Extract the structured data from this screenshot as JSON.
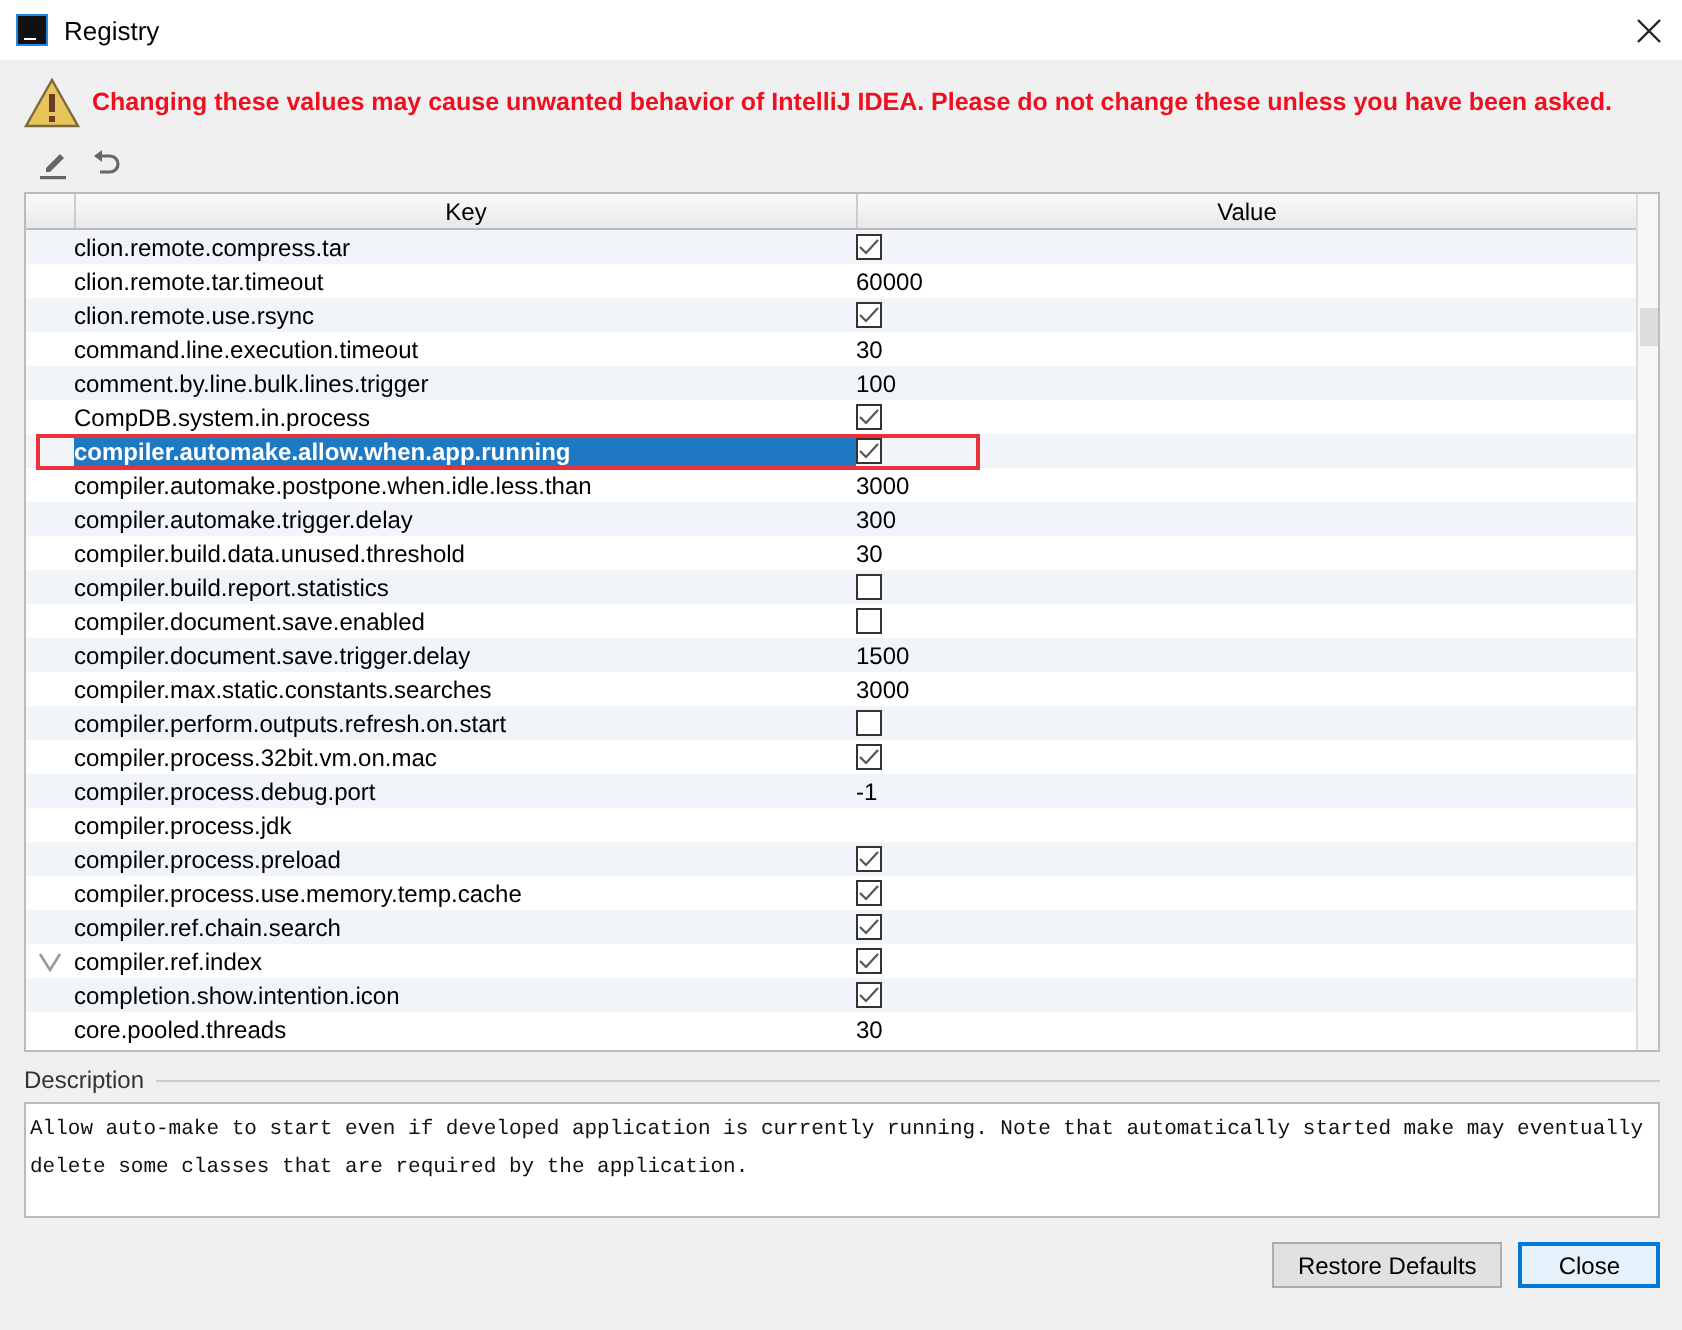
{
  "window": {
    "title": "Registry"
  },
  "warning": "Changing these values may cause unwanted behavior of IntelliJ IDEA. Please do not change these unless you have been asked.",
  "table": {
    "columns": [
      "Key",
      "Value"
    ],
    "rows": [
      {
        "key": "clion.remote.compress.tar",
        "kind": "checkbox",
        "checked": true,
        "selected": false,
        "modified": false,
        "annotated": false
      },
      {
        "key": "clion.remote.tar.timeout",
        "kind": "text",
        "value": "60000",
        "selected": false,
        "modified": false,
        "annotated": false
      },
      {
        "key": "clion.remote.use.rsync",
        "kind": "checkbox",
        "checked": true,
        "selected": false,
        "modified": false,
        "annotated": false
      },
      {
        "key": "command.line.execution.timeout",
        "kind": "text",
        "value": "30",
        "selected": false,
        "modified": false,
        "annotated": false
      },
      {
        "key": "comment.by.line.bulk.lines.trigger",
        "kind": "text",
        "value": "100",
        "selected": false,
        "modified": false,
        "annotated": false
      },
      {
        "key": "CompDB.system.in.process",
        "kind": "checkbox",
        "checked": true,
        "selected": false,
        "modified": false,
        "annotated": false
      },
      {
        "key": "compiler.automake.allow.when.app.running",
        "kind": "checkbox",
        "checked": true,
        "selected": true,
        "modified": false,
        "annotated": true
      },
      {
        "key": "compiler.automake.postpone.when.idle.less.than",
        "kind": "text",
        "value": "3000",
        "selected": false,
        "modified": false,
        "annotated": false
      },
      {
        "key": "compiler.automake.trigger.delay",
        "kind": "text",
        "value": "300",
        "selected": false,
        "modified": false,
        "annotated": false
      },
      {
        "key": "compiler.build.data.unused.threshold",
        "kind": "text",
        "value": "30",
        "selected": false,
        "modified": false,
        "annotated": false
      },
      {
        "key": "compiler.build.report.statistics",
        "kind": "checkbox",
        "checked": false,
        "selected": false,
        "modified": false,
        "annotated": false
      },
      {
        "key": "compiler.document.save.enabled",
        "kind": "checkbox",
        "checked": false,
        "selected": false,
        "modified": false,
        "annotated": false
      },
      {
        "key": "compiler.document.save.trigger.delay",
        "kind": "text",
        "value": "1500",
        "selected": false,
        "modified": false,
        "annotated": false
      },
      {
        "key": "compiler.max.static.constants.searches",
        "kind": "text",
        "value": "3000",
        "selected": false,
        "modified": false,
        "annotated": false
      },
      {
        "key": "compiler.perform.outputs.refresh.on.start",
        "kind": "checkbox",
        "checked": false,
        "selected": false,
        "modified": false,
        "annotated": false
      },
      {
        "key": "compiler.process.32bit.vm.on.mac",
        "kind": "checkbox",
        "checked": true,
        "selected": false,
        "modified": false,
        "annotated": false
      },
      {
        "key": "compiler.process.debug.port",
        "kind": "text",
        "value": "-1",
        "selected": false,
        "modified": false,
        "annotated": false
      },
      {
        "key": "compiler.process.jdk",
        "kind": "empty",
        "selected": false,
        "modified": false,
        "annotated": false
      },
      {
        "key": "compiler.process.preload",
        "kind": "checkbox",
        "checked": true,
        "selected": false,
        "modified": false,
        "annotated": false
      },
      {
        "key": "compiler.process.use.memory.temp.cache",
        "kind": "checkbox",
        "checked": true,
        "selected": false,
        "modified": false,
        "annotated": false
      },
      {
        "key": "compiler.ref.chain.search",
        "kind": "checkbox",
        "checked": true,
        "selected": false,
        "modified": false,
        "annotated": false
      },
      {
        "key": "compiler.ref.index",
        "kind": "checkbox",
        "checked": true,
        "selected": false,
        "modified": true,
        "annotated": false
      },
      {
        "key": "completion.show.intention.icon",
        "kind": "checkbox",
        "checked": true,
        "selected": false,
        "modified": false,
        "annotated": false
      },
      {
        "key": "core.pooled.threads",
        "kind": "text",
        "value": "30",
        "selected": false,
        "modified": false,
        "annotated": false
      }
    ]
  },
  "description": {
    "label": "Description",
    "text": "Allow auto-make to start even if developed application is currently running. Note that automatically started make may eventually delete some classes that are required by the application."
  },
  "buttons": [
    {
      "label": "Restore Defaults",
      "default": false
    },
    {
      "label": "Close",
      "default": true
    }
  ]
}
